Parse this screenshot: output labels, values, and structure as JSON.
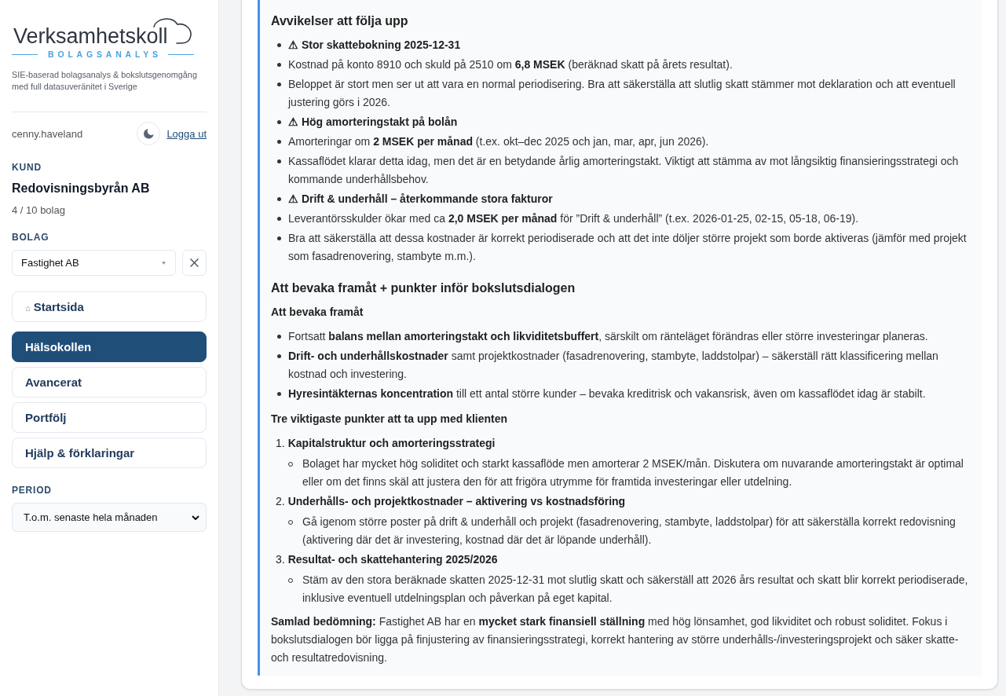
{
  "sidebar": {
    "logo": {
      "name": "Verksamhetskoll",
      "subtitle": "BOLAGSANALYS"
    },
    "tagline": "SIE-baserad bolagsanalys & bokslutsgenomgång med full datasuveränitet i Sverige",
    "user": {
      "name": "cenny.haveland",
      "logout": "Logga ut"
    },
    "customer": {
      "label": "KUND",
      "name": "Redovisningsbyrån AB",
      "count": "4 / 10 bolag"
    },
    "company": {
      "label": "BOLAG",
      "value": "Fastighet AB"
    },
    "nav": [
      {
        "glyph": "⌂",
        "label": "Startsida",
        "selected": false
      },
      {
        "label": "Hälsokollen",
        "selected": true
      },
      {
        "label": "Avancerat",
        "selected": false
      },
      {
        "label": "Portfölj",
        "selected": false
      },
      {
        "label": "Hjälp & förklaringar",
        "selected": false
      }
    ],
    "period": {
      "label": "PERIOD",
      "value": "T.o.m. senaste hela månaden"
    }
  },
  "report": {
    "blocks": [
      {
        "kind": "heading",
        "text": "Avvikelser att följa upp"
      },
      {
        "kind": "bullets",
        "items": [
          {
            "kind": "heading",
            "title": "⚠ Stor skattebokning 2025-12-31"
          },
          {
            "kind": "text",
            "text": "Kostnad på konto 8910 och skuld på 2510 om **6,8 MSEK** (beräknad skatt på årets resultat)."
          },
          {
            "kind": "text",
            "text": "Beloppet är stort men ser ut att vara en normal periodisering. Bra att säkerställa att slutlig skatt stämmer mot deklaration och att eventuell justering görs i 2026."
          },
          {
            "kind": "heading",
            "title": "⚠ Hög amorteringstakt på bolån"
          },
          {
            "kind": "text",
            "text": "Amorteringar om **2 MSEK per månad** (t.ex. okt–dec 2025 och jan, mar, apr, jun 2026)."
          },
          {
            "kind": "text",
            "text": "Kassaflödet klarar detta idag, men det är en betydande årlig amorteringstakt. Viktigt att stämma av mot långsiktig finansieringsstrategi och kommande underhållsbehov."
          },
          {
            "kind": "heading",
            "title": "⚠ Drift & underhåll – återkommande stora fakturor"
          },
          {
            "kind": "text",
            "text": "Leverantörsskulder ökar med ca **2,0 MSEK per månad** för ”Drift & underhåll” (t.ex. 2026-01-25, 02-15, 05-18, 06-19)."
          },
          {
            "kind": "text",
            "text": "Bra att säkerställa att dessa kostnader är korrekt periodiserade och att det inte döljer större projekt som borde aktiveras (jämför med projekt som fasadrenovering, stambyte m.m.)."
          }
        ]
      },
      {
        "kind": "heading",
        "text": "Att bevaka framåt + punkter inför bokslutsdialogen"
      },
      {
        "kind": "subheading",
        "text": "Att bevaka framåt"
      },
      {
        "kind": "bullets",
        "items": [
          {
            "kind": "text",
            "text": "Fortsatt **balans mellan amorteringstakt och likviditetsbuffert**, särskilt om ränteläget förändras eller större investeringar planeras."
          },
          {
            "kind": "text",
            "text": "**Drift- och underhållskostnader** samt projektkostnader (fasadrenovering, stambyte, laddstolpar) – säkerställ rätt klassificering mellan kostnad och investering."
          },
          {
            "kind": "text",
            "text": "**Hyresintäkternas koncentration** till ett antal större kunder – bevaka kreditrisk och vakansrisk, även om kassaflödet idag är stabilt."
          }
        ]
      },
      {
        "kind": "subheading",
        "text": "Tre viktigaste punkter att ta upp med klienten"
      },
      {
        "kind": "numbered",
        "items": [
          {
            "number": "1.",
            "title": "Kapitalstruktur och amorteringsstrategi",
            "children": [
              {
                "text": "Bolaget har mycket hög soliditet och starkt kassaflöde men amorterar 2 MSEK/mån. Diskutera om nuvarande amorteringstakt är optimal eller om det finns skäl att justera den för att frigöra utrymme för framtida investeringar eller utdelning."
              }
            ]
          },
          {
            "number": "2.",
            "title": "Underhålls- och projektkostnader – aktivering vs kostnadsföring",
            "children": [
              {
                "text": "Gå igenom större poster på drift & underhåll och projekt (fasadrenovering, stambyte, laddstolpar) för att säkerställa korrekt redovisning (aktivering där det är investering, kostnad där det är löpande underhåll)."
              }
            ]
          },
          {
            "number": "3.",
            "title": "Resultat- och skattehantering 2025/2026",
            "children": [
              {
                "text": "Stäm av den stora beräknade skatten 2025-12-31 mot slutlig skatt och säkerställ att 2026 års resultat och skatt blir korrekt periodiserade, inklusive eventuell utdelningsplan och påverkan på eget kapital."
              }
            ]
          }
        ]
      },
      {
        "kind": "paragraph",
        "text": "**Samlad bedömning:** Fastighet AB har en **mycket stark finansiell ställning** med hög lönsamhet, god likviditet och robust soliditet. Fokus i bokslutsdialogen bör ligga på finjustering av finansieringsstrategi, korrekt hantering av större underhålls-/investeringsprojekt och säker skatte- och resultatredovisning."
      }
    ]
  }
}
